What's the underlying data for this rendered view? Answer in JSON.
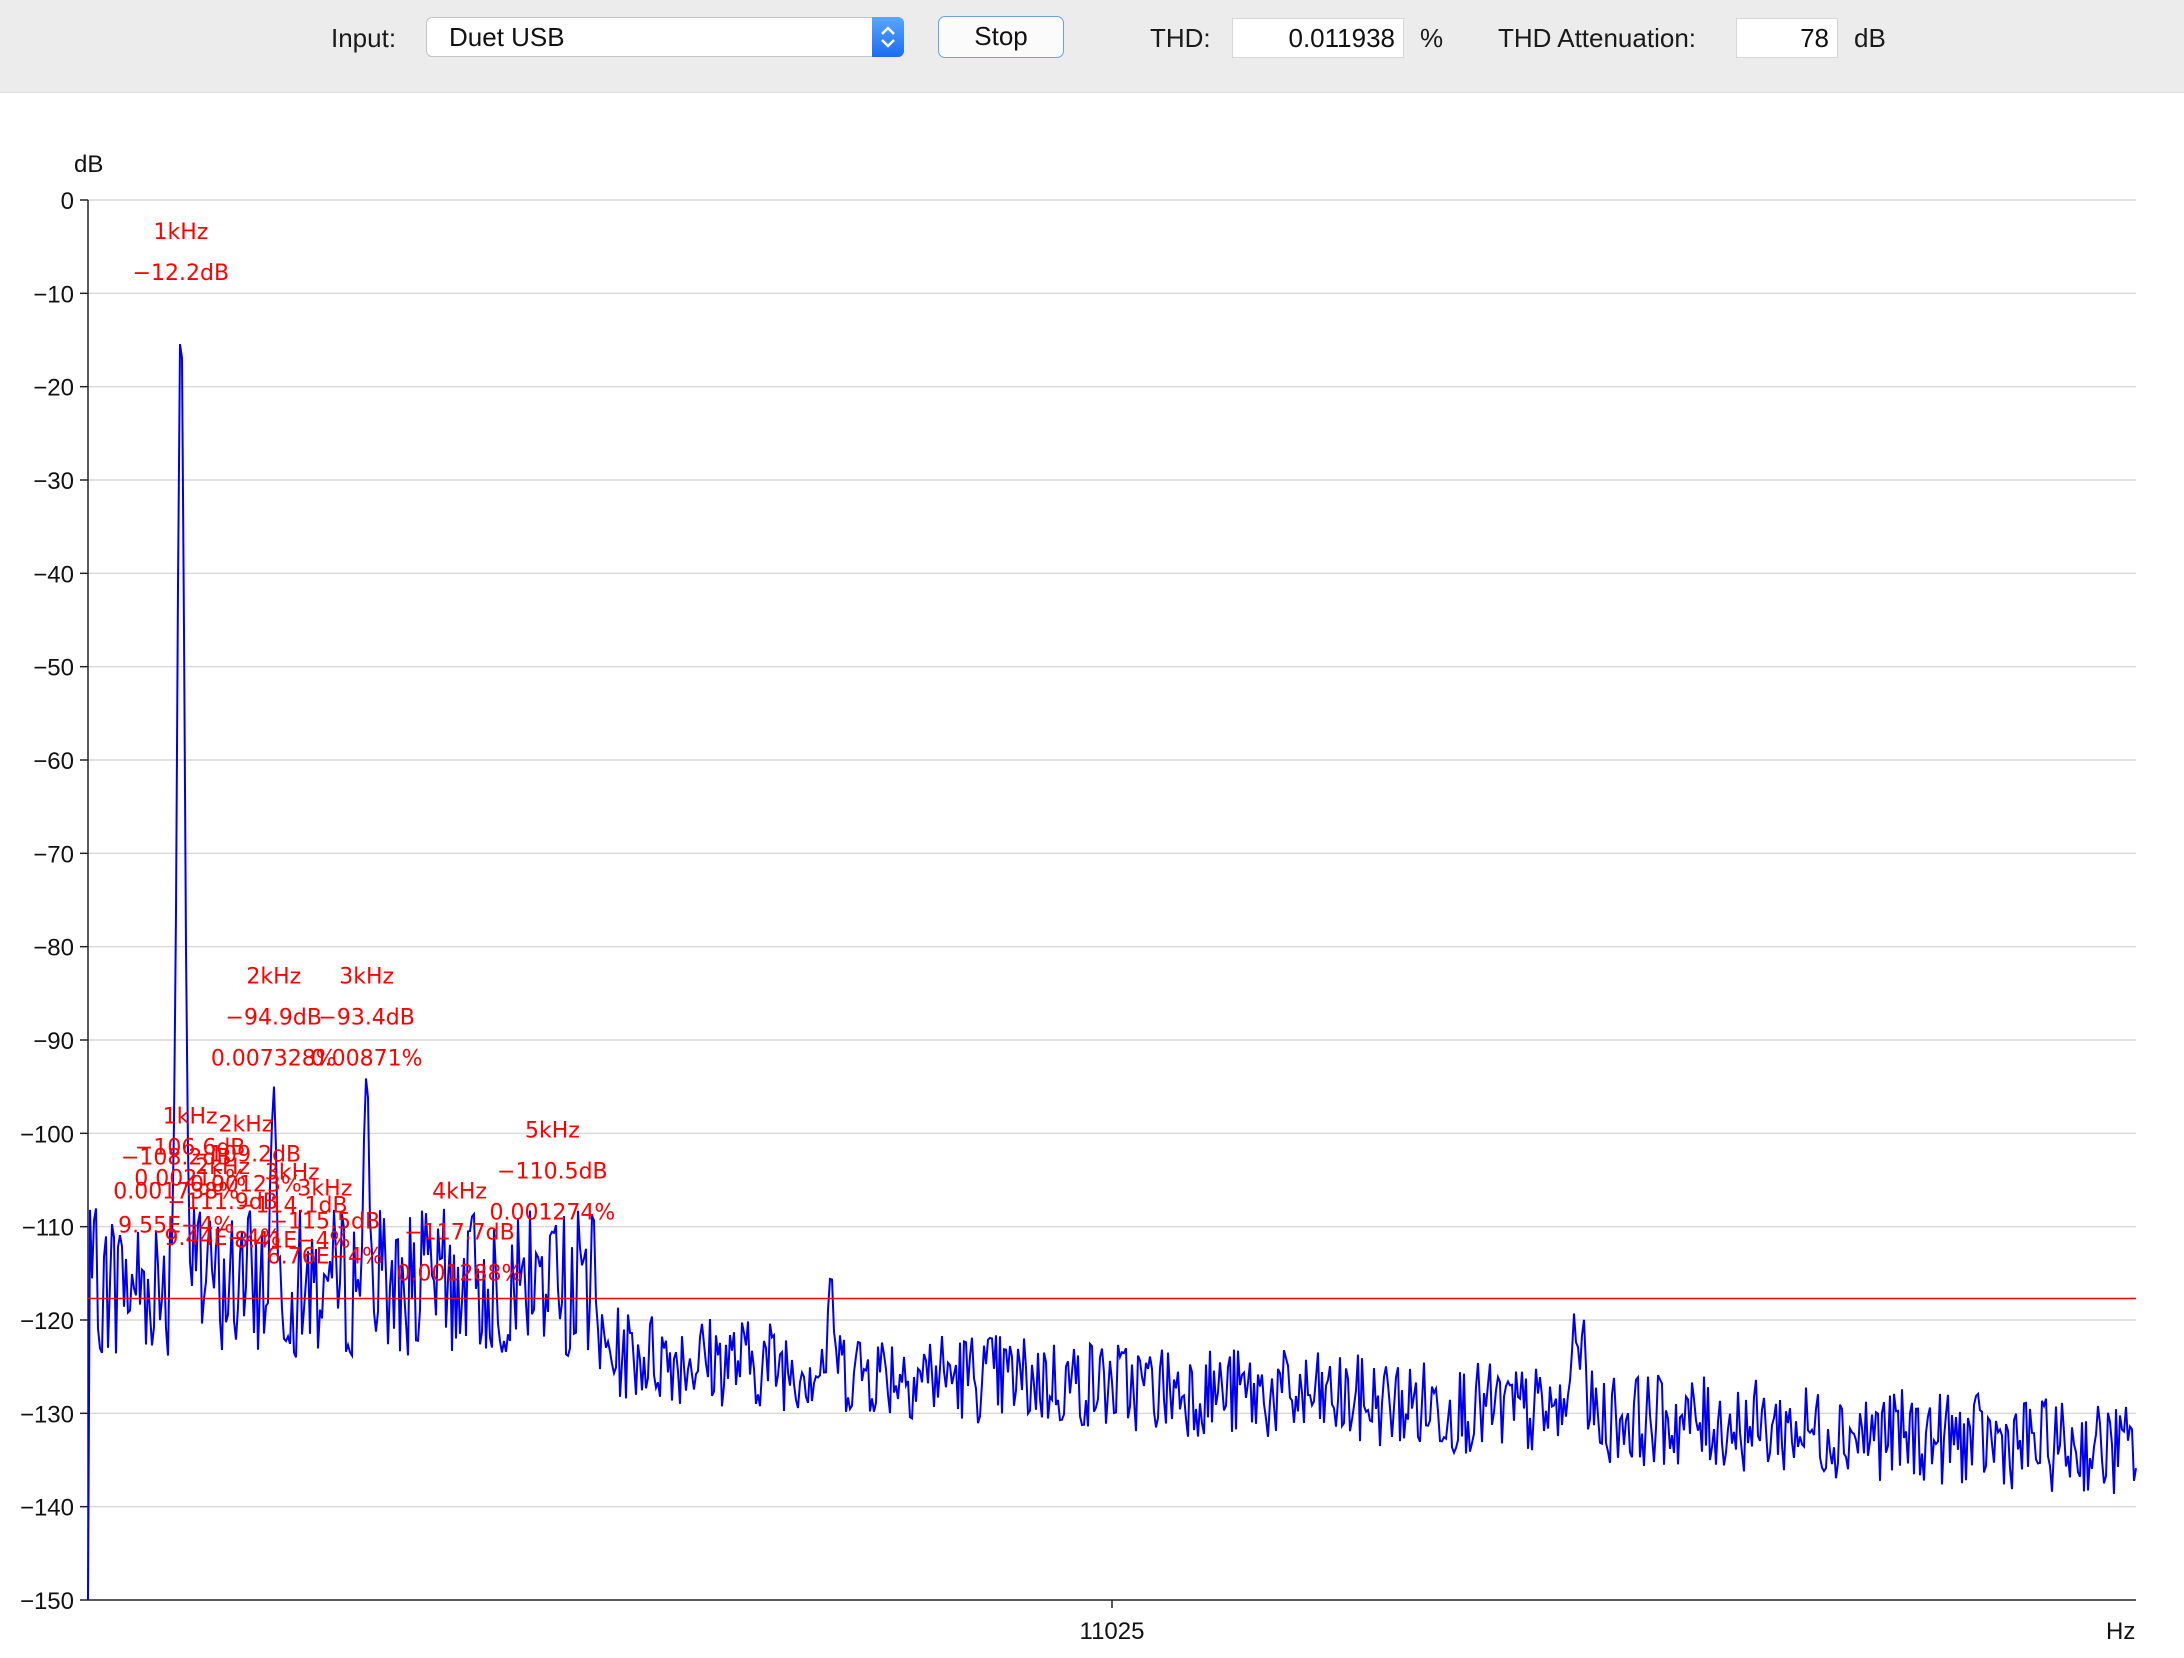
{
  "toolbar": {
    "input_label": "Input:",
    "input_value": "Duet USB",
    "stop_label": "Stop",
    "thd_label": "THD:",
    "thd_value": "0.011938",
    "thd_unit": "%",
    "att_label": "THD Attenuation:",
    "att_value": "78",
    "att_unit": "dB"
  },
  "colors": {
    "trace": "#0000ee",
    "annotation": "#ff0000",
    "threshold": "#ff0000",
    "grid": "#d0d0d0"
  },
  "chart_data": {
    "type": "line",
    "xlabel": "Hz",
    "ylabel": "dB",
    "ylim": [
      -150,
      0
    ],
    "xlim": [
      0,
      22050
    ],
    "x_ticks": [
      11025
    ],
    "y_ticks": [
      0,
      -10,
      -20,
      -30,
      -40,
      -50,
      -60,
      -70,
      -80,
      -90,
      -100,
      -110,
      -120,
      -130,
      -140,
      -150
    ],
    "grid": true,
    "threshold_db": -117.7,
    "peaks": [
      {
        "x": 1000,
        "y": -12.2
      },
      {
        "x": 2000,
        "y": -94.9
      },
      {
        "x": 3000,
        "y": -93.4
      },
      {
        "x": 5000,
        "y": -110.5
      },
      {
        "x": 8000,
        "y": -115.2
      },
      {
        "x": 16000,
        "y": -119.3
      },
      {
        "x": 16100,
        "y": -119.8
      }
    ],
    "annotations": [
      {
        "lines": [
          "1kHz",
          "-12.2dB"
        ],
        "x": 1000,
        "y": -12.2,
        "dy": [
          -75,
          -34
        ]
      },
      {
        "lines": [
          "2kHz",
          "-94.9dB",
          "0.007328%"
        ],
        "x": 2000,
        "y": -94.9,
        "dy": [
          -102,
          -61,
          -20
        ]
      },
      {
        "lines": [
          "3kHz",
          "-93.4dB",
          "0.00871%"
        ],
        "x": 3000,
        "y": -93.4,
        "dy": [
          -88,
          -47,
          -6
        ]
      },
      {
        "lines": [
          "5kHz",
          "-110.5dB",
          "0.001274%"
        ],
        "x": 5000,
        "y": -110.5,
        "dy": [
          -94,
          -53,
          -12
        ]
      },
      {
        "lines": [
          "4kHz",
          "-117.7dB",
          "0.001288%"
        ],
        "x": 4000,
        "y": -117.7,
        "dy": [
          -100,
          -59,
          -18
        ]
      },
      {
        "lines": [
          "1kHz",
          "-106.6dB",
          "0.00215%"
        ],
        "x": 1100,
        "y": -107.5,
        "dy": [
          -80,
          -49,
          -18
        ]
      },
      {
        "lines": [
          "2kHz",
          "-109.2dB",
          "0.00123%"
        ],
        "x": 1700,
        "y": -109,
        "dy": [
          -86,
          -56,
          -26
        ]
      },
      {
        "lines": [
          "2kHz",
          "-111.9dB",
          "9.44E-4%"
        ],
        "x": 1450,
        "y": -110.8,
        "dy": [
          -60,
          -25,
          11
        ]
      },
      {
        "lines": [
          "3kHz",
          "-114.1dB",
          "8.41E-4%"
        ],
        "x": 2200,
        "y": -112,
        "dy": [
          -66,
          -33,
          2
        ]
      },
      {
        "lines": [
          "3kHz",
          "-115.5dB",
          "6.76E-4%"
        ],
        "x": 2550,
        "y": -113.5,
        "dy": [
          -64,
          -31,
          4
        ]
      },
      {
        "lines": [
          "-108.2dB",
          "0.001738%",
          "9.55E-4%"
        ],
        "x": 950,
        "y": -108.5,
        "dy": [
          -48,
          -14,
          20
        ]
      }
    ]
  }
}
